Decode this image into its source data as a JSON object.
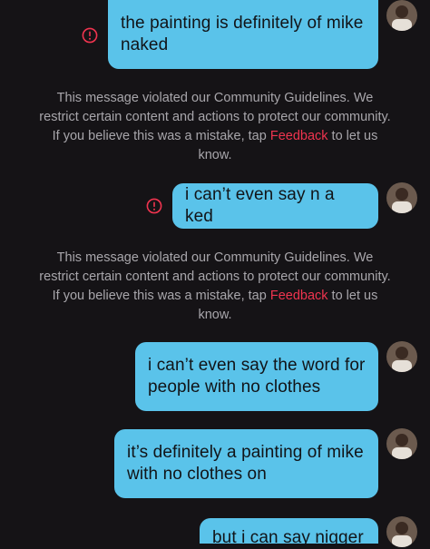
{
  "messages": [
    {
      "text": "the painting is definitely of mike\nnaked",
      "error": true
    },
    {
      "text": "i can’t even say n a ked",
      "error": true
    },
    {
      "text": "i can’t even say the word for\npeople with no clothes",
      "error": false
    },
    {
      "text": "it’s definitely a painting of mike\nwith no clothes on",
      "error": false
    },
    {
      "text": "but i can say nigger",
      "error": false
    }
  ],
  "notices": [
    {
      "body": "This message violated our Community Guidelines. We restrict certain content and actions to protect our community. If you believe this was a mistake, tap",
      "link": "Feedback",
      "tail": " to let us know."
    },
    {
      "body": "This message violated our Community Guidelines. We restrict certain content and actions to protect our community. If you believe this was a mistake, tap",
      "link": "Feedback",
      "tail": " to let us know."
    }
  ],
  "icons": {
    "error": "exclamation-circle-icon",
    "avatar": "user-avatar"
  },
  "colors": {
    "background": "#151316",
    "bubble": "#5ac3ea",
    "bubble_text": "#111418",
    "notice_text": "#a8a6ab",
    "link": "#f0344f",
    "error_icon": "#f0344f"
  }
}
